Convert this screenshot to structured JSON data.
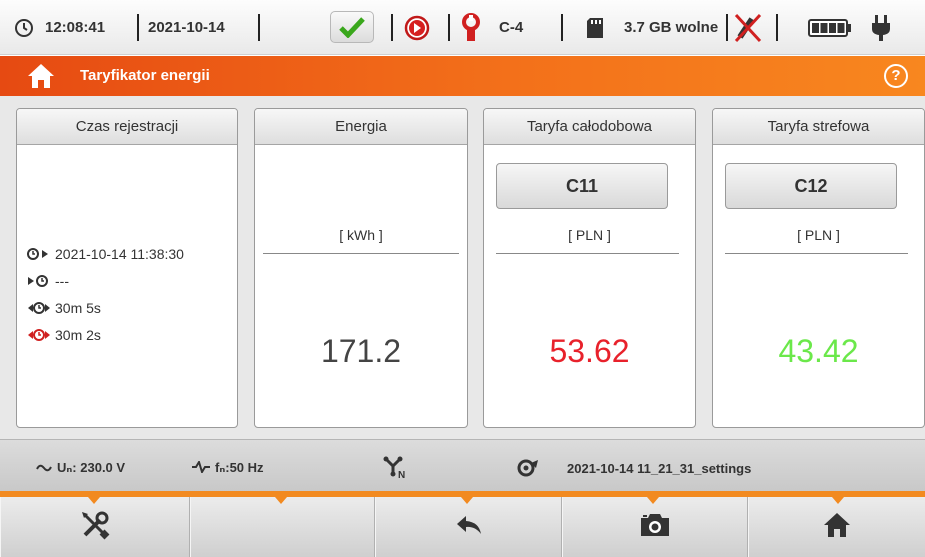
{
  "status": {
    "time": "12:08:41",
    "date": "2021-10-14",
    "clamp_label": "C-4",
    "storage": "3.7 GB wolne"
  },
  "header": {
    "title": "Taryfikator energii"
  },
  "panels": {
    "registration": {
      "title": "Czas rejestracji",
      "rows": [
        {
          "icon": "clock-start-icon",
          "value": "2021-10-14 11:38:30"
        },
        {
          "icon": "clock-stop-icon",
          "value": "---"
        },
        {
          "icon": "clock-duration-icon",
          "value": "30m 5s"
        },
        {
          "icon": "clock-duration-red-icon",
          "value": "30m 2s"
        }
      ]
    },
    "energy": {
      "title": "Energia",
      "unit": "[ kWh ]",
      "value": "171.2"
    },
    "tariff_flat": {
      "title": "Taryfa całodobowa",
      "button": "C11",
      "unit": "[ PLN ]",
      "value": "53.62",
      "color": "#e8212b"
    },
    "tariff_zone": {
      "title": "Taryfa strefowa",
      "button": "C12",
      "unit": "[ PLN ]",
      "value": "43.42",
      "color": "#6be84a"
    }
  },
  "info": {
    "voltage": "Uₙ: 230.0 V",
    "frequency": "fₙ:50 Hz",
    "settings_file": "2021-10-14 11_21_31_settings"
  },
  "nav": [
    "settings-tools-icon",
    "empty",
    "back-arrow-icon",
    "camera-icon",
    "home-icon"
  ],
  "colors": {
    "accent": "#f28a20",
    "title_orange": "#e64a12"
  }
}
